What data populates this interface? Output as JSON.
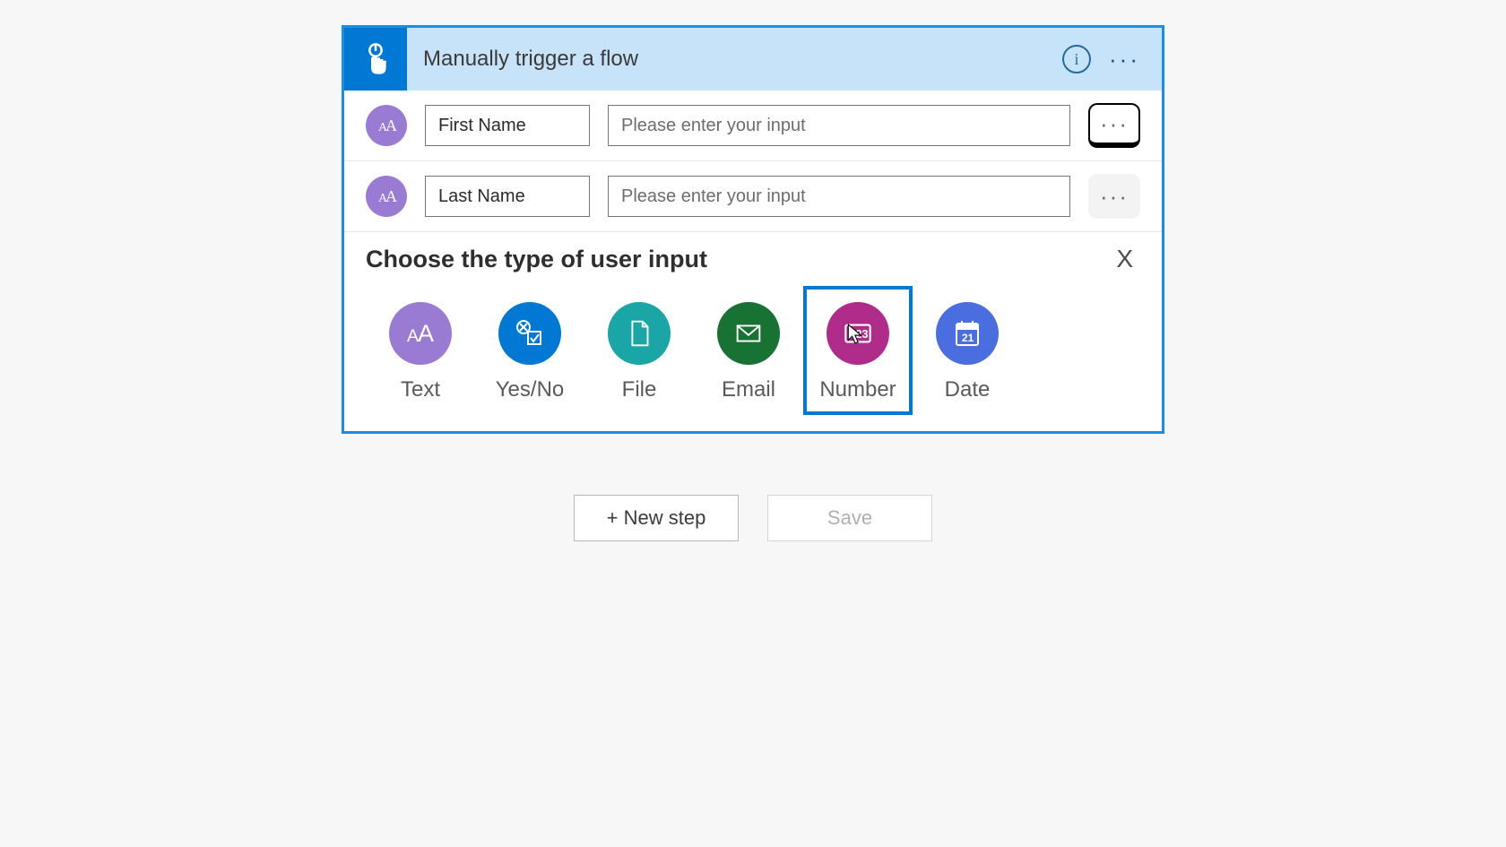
{
  "trigger": {
    "title": "Manually trigger a flow",
    "inputs": [
      {
        "label": "First Name",
        "placeholder": "Please enter your input"
      },
      {
        "label": "Last Name",
        "placeholder": "Please enter your input"
      }
    ],
    "choose": {
      "title": "Choose the type of user input",
      "close": "X",
      "types": [
        {
          "name": "Text",
          "color": "text"
        },
        {
          "name": "Yes/No",
          "color": "yesno"
        },
        {
          "name": "File",
          "color": "file"
        },
        {
          "name": "Email",
          "color": "email"
        },
        {
          "name": "Number",
          "color": "number",
          "selected": true
        },
        {
          "name": "Date",
          "color": "date"
        }
      ]
    }
  },
  "buttons": {
    "new_step": "+ New step",
    "save": "Save"
  }
}
